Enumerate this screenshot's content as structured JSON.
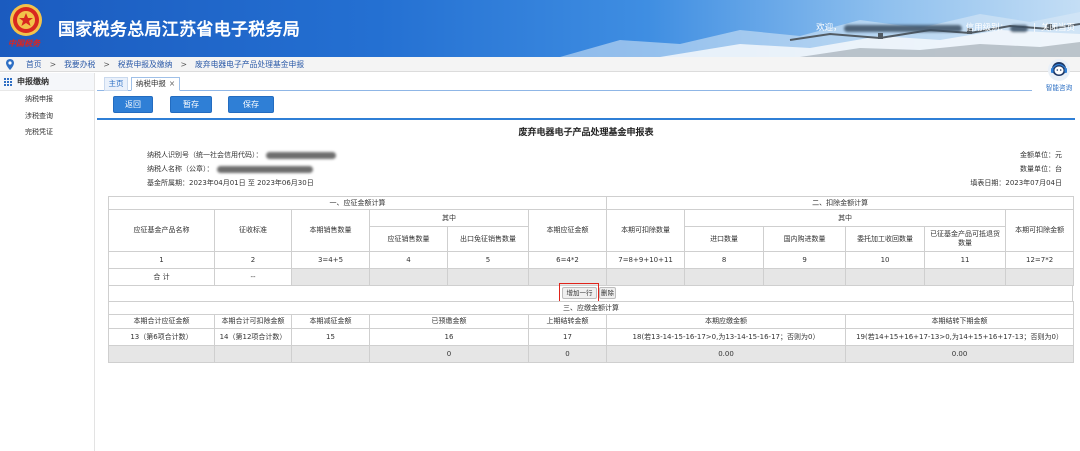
{
  "header": {
    "logo_text": "中国税务",
    "title": "国家税务总局江苏省电子税务局",
    "welcome": "欢迎，",
    "credit_label": "信用级别：",
    "separator": "|",
    "close_label": "关闭当页"
  },
  "breadcrumb": {
    "items": [
      "首页",
      "我要办税",
      "税费申报及缴纳",
      "废弃电器电子产品处理基金申报"
    ],
    "separator": ">"
  },
  "assistant": {
    "label": "智能咨询"
  },
  "sidebar": {
    "section": "申报缴纳",
    "items": [
      "纳税申报",
      "涉税查询",
      "完税凭证"
    ]
  },
  "tabs": [
    {
      "label": "主页"
    },
    {
      "label": "纳税申报",
      "close": "×"
    }
  ],
  "toolbar": {
    "back": "返回",
    "draft": "暂存",
    "save": "保存"
  },
  "form": {
    "title": "废弃电器电子产品处理基金申报表",
    "taxpayer_id_label": "纳税人识别号（统一社会信用代码）：",
    "taxpayer_name_label": "纳税人名称（公章）：",
    "period": "基金所属期：2023年04月01日 至 2023年06月30日",
    "amount_unit": "金额单位：元",
    "qty_unit": "数量单位：台",
    "fill_date": "填表日期：2023年07月04日"
  },
  "table1": {
    "group_a": "一、应征金额计算",
    "group_b": "二、扣除金额计算",
    "col_product": "应征基金产品名称",
    "col_standard": "征收标准",
    "col_sales_qty": "本期销售数量",
    "sub_a": "其中",
    "col_taxable_qty": "应征销售数量",
    "col_export_qty": "出口免征销售数量",
    "col_levy_amount": "本期应征金额",
    "col_deduct_qty": "本期可扣除数量",
    "sub_b": "其中",
    "col_import_qty": "进口数量",
    "col_domestic_qty": "国内购进数量",
    "col_consigned_qty": "委托加工收回数量",
    "col_return_qty": "已征基金产品可抵退货数量",
    "col_deduct_amount": "本期可扣除金额",
    "row_numbers": [
      "1",
      "2",
      "3=4+5",
      "4",
      "5",
      "6=4*2",
      "7=8+9+10+11",
      "8",
      "9",
      "10",
      "11",
      "12=7*2"
    ],
    "total_row": {
      "label": "合 计",
      "standard": "--"
    }
  },
  "row_actions": {
    "add": "增加一行",
    "delete": "删除"
  },
  "table2": {
    "group": "三、应缴金额计算",
    "headers": [
      "本期合计应征金额",
      "本期合计可扣除金额",
      "本期减征金额",
      "已预缴金额",
      "上期结转金额",
      "本期应缴金额",
      "本期结转下期金额"
    ],
    "formulas": [
      "13（第6项合计数）",
      "14（第12项合计数）",
      "15",
      "16",
      "17",
      "18(若13-14-15-16-17>0,为13-14-15-16-17；否则为0）",
      "19(若14+15+16+17-13>0,为14+15+16+17-13；否则为0）"
    ],
    "values": [
      "",
      "",
      "",
      "0",
      "0",
      "0.00",
      "0.00"
    ]
  },
  "colors": {
    "primary_blue": "#2f7fd6",
    "highlight_red": "#e0241b",
    "disabled_cell": "#e6e6e6"
  }
}
